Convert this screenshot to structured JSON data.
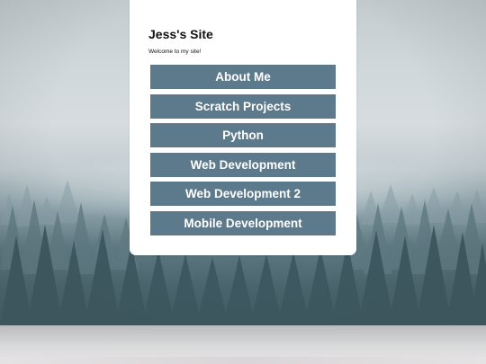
{
  "site": {
    "title": "Jess's Site",
    "welcome": "Welcome to my site!"
  },
  "nav": {
    "items": [
      {
        "label": "About Me"
      },
      {
        "label": "Scratch Projects"
      },
      {
        "label": "Python"
      },
      {
        "label": "Web Development"
      },
      {
        "label": "Web Development 2"
      },
      {
        "label": "Mobile Development"
      }
    ]
  },
  "colors": {
    "button_bg": "#5d7a8c",
    "button_text": "#ffffff",
    "card_bg": "#ffffff"
  },
  "background": {
    "image": "misty-forest-photo"
  }
}
